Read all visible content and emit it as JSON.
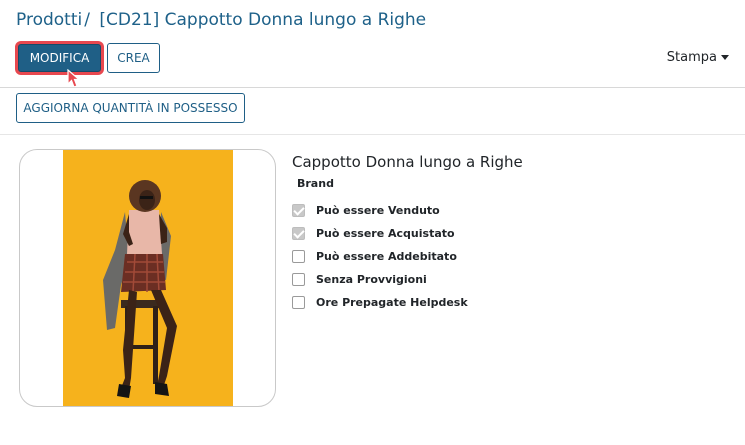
{
  "breadcrumb": {
    "parent": "Prodotti",
    "separator": "/",
    "current": "[CD21] Cappotto Donna lungo a Righe"
  },
  "toolbar": {
    "edit_label": "MODIFICA",
    "create_label": "CREA",
    "print_label": "Stampa",
    "update_qty_label": "AGGIORNA QUANTITÀ IN POSSESSO"
  },
  "product": {
    "name": "Cappotto Donna lungo a Righe",
    "brand_label": "Brand",
    "image_icon": "product-photo",
    "options": [
      {
        "label": "Può essere Venduto",
        "checked": true
      },
      {
        "label": "Può essere Acquistato",
        "checked": true
      },
      {
        "label": "Può essere Addebitato",
        "checked": false
      },
      {
        "label": "Senza Provvigioni",
        "checked": false
      },
      {
        "label": "Ore Prepagate Helpdesk",
        "checked": false
      }
    ]
  },
  "colors": {
    "primary": "#1f5f86",
    "highlight": "#e8484f",
    "photo_background": "#f6b21c"
  }
}
